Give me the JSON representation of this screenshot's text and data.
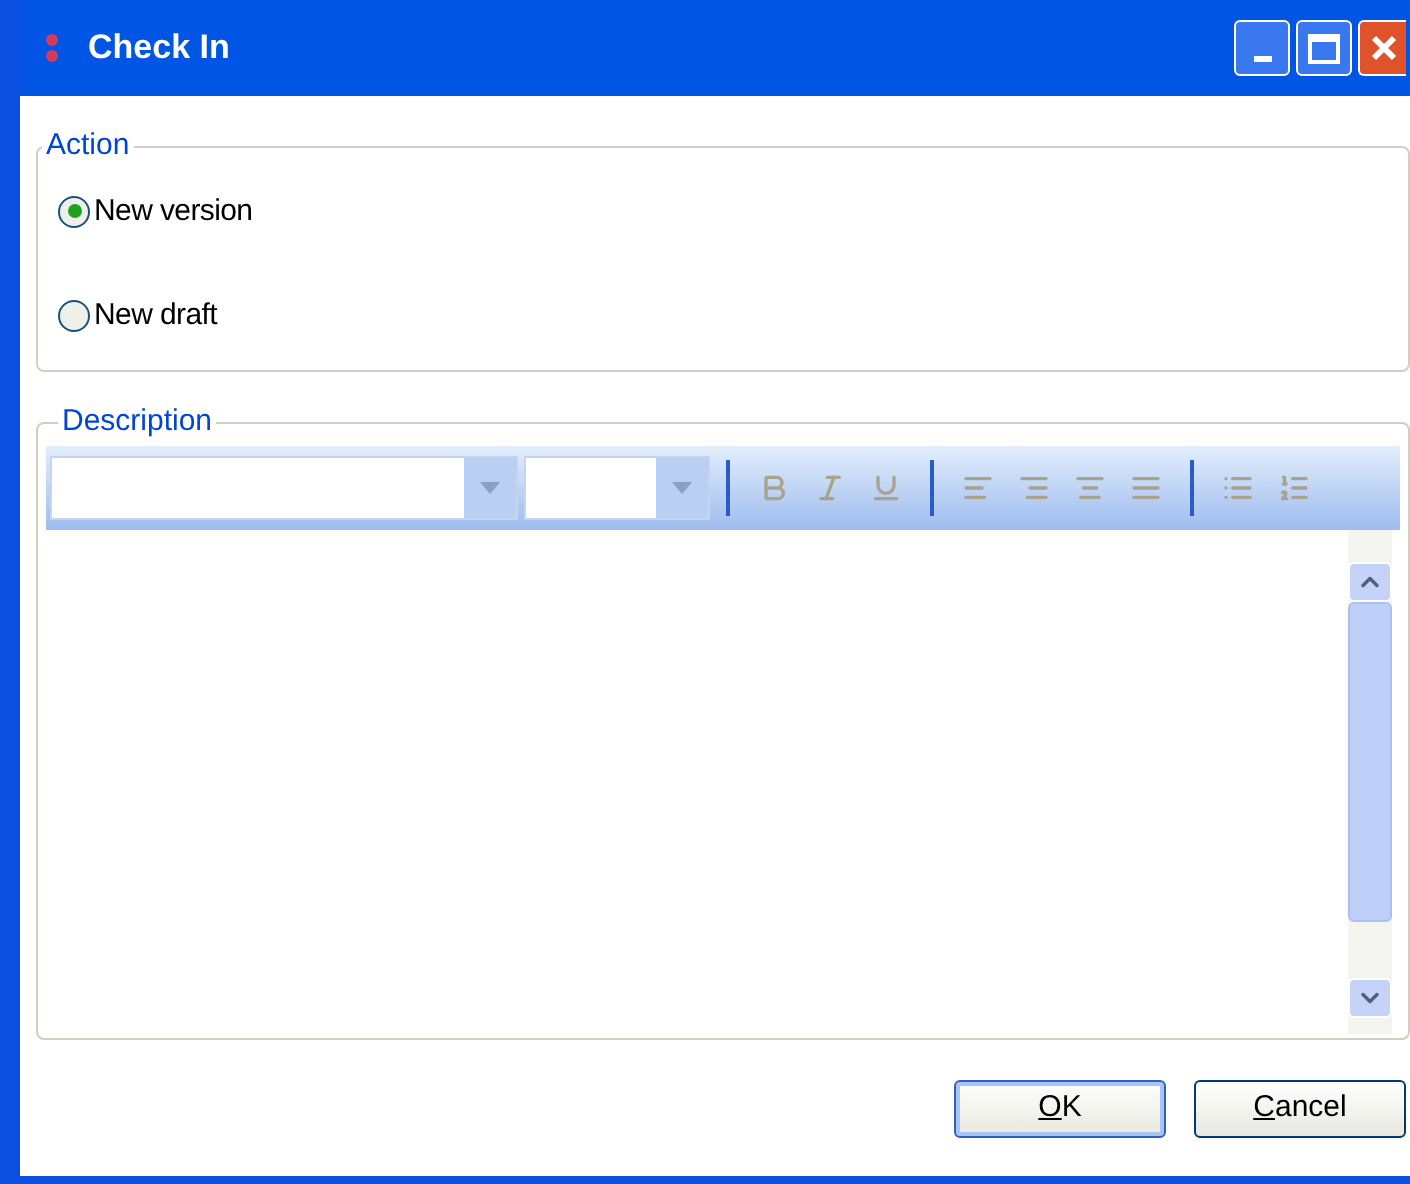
{
  "window": {
    "title": "Check In"
  },
  "action": {
    "legend": "Action",
    "options": [
      {
        "label": "New version",
        "selected": true
      },
      {
        "label": "New draft",
        "selected": false
      }
    ]
  },
  "description": {
    "legend": "Description",
    "toolbar": {
      "disabled": true
    }
  },
  "buttons": [
    {
      "label": "OK",
      "default": true
    },
    {
      "label": "Cancel",
      "default": false
    }
  ]
}
